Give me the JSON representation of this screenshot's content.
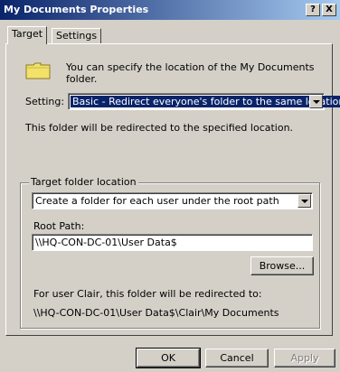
{
  "window": {
    "title": "My Documents Properties",
    "help_label": "?",
    "close_label": "X"
  },
  "tabs": [
    {
      "label": "Target",
      "active": true
    },
    {
      "label": "Settings",
      "active": false
    }
  ],
  "intro_text": "You can specify the location of the My Documents folder.",
  "setting": {
    "label": "Setting:",
    "value": "Basic - Redirect everyone's folder to the same location"
  },
  "redirect_note": "This folder will be redirected to the specified location.",
  "target_group": {
    "legend": "Target folder location",
    "option_value": "Create a folder for each user under the root path",
    "root_path_label": "Root Path:",
    "root_path_value": "\\\\HQ-CON-DC-01\\User Data$",
    "browse_label": "Browse...",
    "example_caption": "For user Clair, this folder will be redirected to:",
    "example_path": "\\\\HQ-CON-DC-01\\User Data$\\Clair\\My Documents"
  },
  "buttons": {
    "ok": "OK",
    "cancel": "Cancel",
    "apply": "Apply"
  },
  "colors": {
    "titlebar_start": "#0a246a",
    "titlebar_end": "#a6caf0",
    "dialog_bg": "#d4d0c8",
    "selection": "#0a246a",
    "folder": "#f2e26a"
  }
}
